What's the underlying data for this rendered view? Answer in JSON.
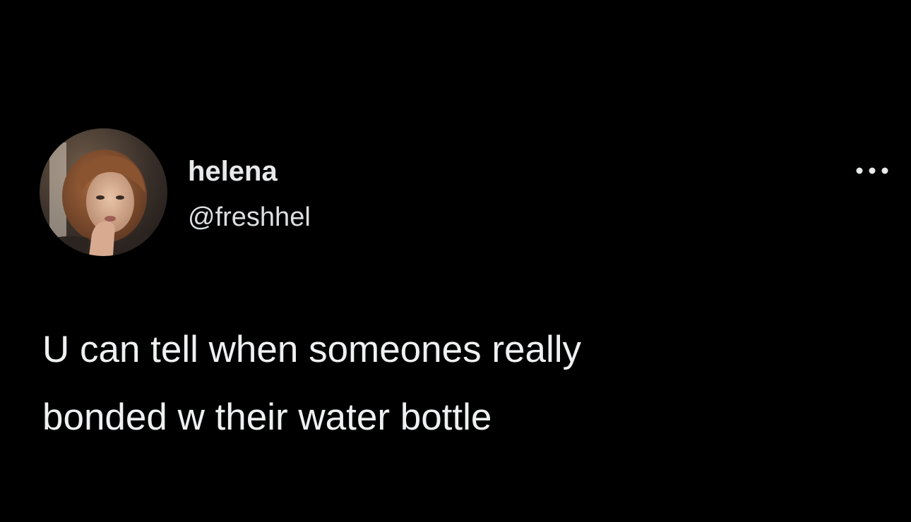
{
  "tweet": {
    "author": {
      "display_name": "helena",
      "handle": "@freshhel",
      "avatar_icon": "profile-photo-avatar"
    },
    "more_icon": "more-horizontal-icon",
    "text_lines": [
      "U can tell when someones really",
      "bonded w their water bottle"
    ]
  },
  "colors": {
    "background": "#000000",
    "text_primary": "#e7e9ea",
    "text_secondary": "#dcdfe1"
  }
}
